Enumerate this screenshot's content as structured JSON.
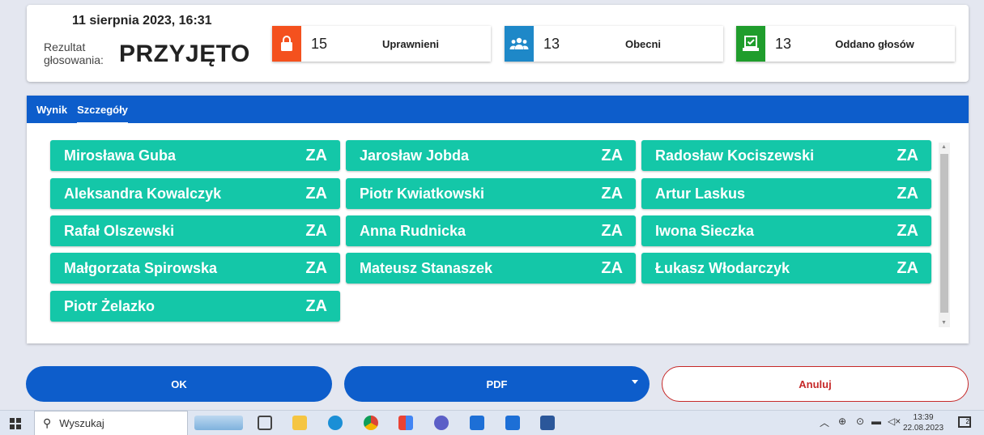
{
  "header": {
    "datetime": "11 sierpnia 2023, 16:31",
    "result_label": "Rezultat głosowania:",
    "result_value": "PRZYJĘTO"
  },
  "stats": [
    {
      "icon": "lock-icon",
      "color": "#f4511e",
      "value": "15",
      "label": "Uprawnieni"
    },
    {
      "icon": "users-icon",
      "color": "#1e88c8",
      "value": "13",
      "label": "Obecni"
    },
    {
      "icon": "vote-check-icon",
      "color": "#1f9d2c",
      "value": "13",
      "label": "Oddano głosów"
    }
  ],
  "tabs": [
    {
      "label": "Wynik",
      "active": false
    },
    {
      "label": "Szczegóły",
      "active": true
    }
  ],
  "voters": [
    {
      "name": "Mirosława Guba",
      "vote": "ZA"
    },
    {
      "name": "Jarosław Jobda",
      "vote": "ZA"
    },
    {
      "name": "Radosław Kociszewski",
      "vote": "ZA"
    },
    {
      "name": "Aleksandra Kowalczyk",
      "vote": "ZA"
    },
    {
      "name": "Piotr Kwiatkowski",
      "vote": "ZA"
    },
    {
      "name": "Artur Laskus",
      "vote": "ZA"
    },
    {
      "name": "Rafał Olszewski",
      "vote": "ZA"
    },
    {
      "name": "Anna Rudnicka",
      "vote": "ZA"
    },
    {
      "name": "Iwona Sieczka",
      "vote": "ZA"
    },
    {
      "name": "Małgorzata Spirowska",
      "vote": "ZA"
    },
    {
      "name": "Mateusz Stanaszek",
      "vote": "ZA"
    },
    {
      "name": "Łukasz Włodarczyk",
      "vote": "ZA"
    },
    {
      "name": "Piotr Żelazko",
      "vote": "ZA"
    }
  ],
  "buttons": {
    "ok": "OK",
    "pdf": "PDF",
    "cancel": "Anuluj"
  },
  "colors": {
    "primary": "#0d5dcb",
    "vote_yes": "#14c7a8",
    "cancel": "#c62828"
  },
  "taskbar": {
    "search_placeholder": "Wyszukaj",
    "time": "13:39",
    "date": "22.08.2023",
    "notification_count": "2"
  }
}
